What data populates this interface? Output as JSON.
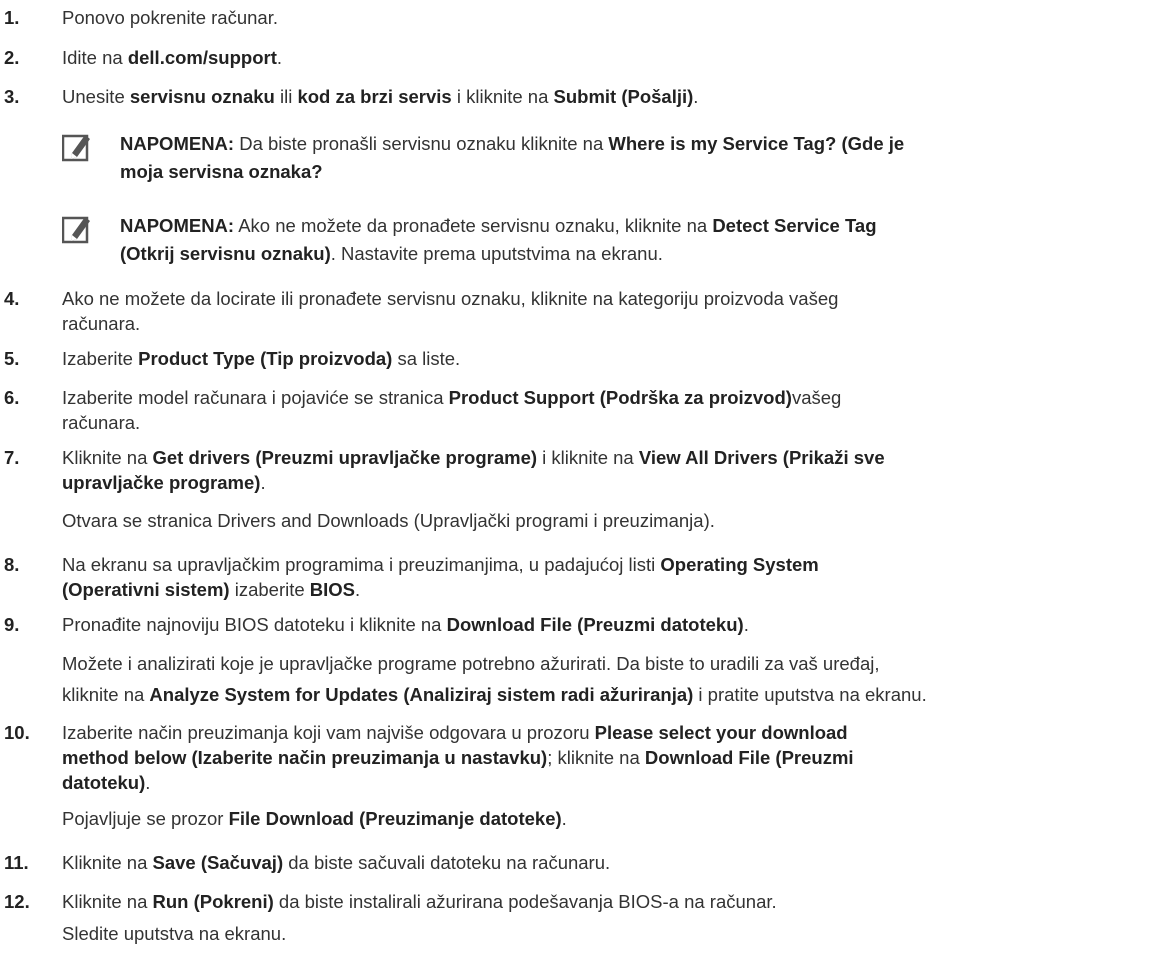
{
  "steps": [
    {
      "num": "1.",
      "parts": [
        {
          "t": "Ponovo pokrenite računar."
        }
      ]
    },
    {
      "num": "2.",
      "parts": [
        {
          "t": "Idite na "
        },
        {
          "b": "dell.com/support"
        },
        {
          "t": "."
        }
      ]
    },
    {
      "num": "3.",
      "parts": [
        {
          "t": "Unesite "
        },
        {
          "b": "servisnu oznaku"
        },
        {
          "t": " ili "
        },
        {
          "b": "kod za brzi servis"
        },
        {
          "t": " i kliknite na "
        },
        {
          "b": "Submit (Pošalji)"
        },
        {
          "t": "."
        }
      ]
    },
    {
      "num": "4.",
      "parts": [
        {
          "t": "Ako ne možete da locirate ili pronađete servisnu oznaku, kliknite na kategoriju proizvoda vašeg"
        }
      ],
      "line2": [
        {
          "t": "računara."
        }
      ]
    },
    {
      "num": "5.",
      "parts": [
        {
          "t": "Izaberite "
        },
        {
          "b": "Product Type (Tip proizvoda)"
        },
        {
          "t": " sa liste."
        }
      ]
    },
    {
      "num": "6.",
      "parts": [
        {
          "t": "Izaberite model računara i pojaviće se stranica "
        },
        {
          "b": "Product Support (Podrška za proizvod)"
        },
        {
          "t": "vašeg"
        }
      ],
      "line2": [
        {
          "t": "računara."
        }
      ]
    },
    {
      "num": "7.",
      "parts": [
        {
          "t": "Kliknite na "
        },
        {
          "b": "Get drivers (Preuzmi upravljačke programe)"
        },
        {
          "t": " i kliknite na "
        },
        {
          "b": "View All Drivers (Prikaži sve"
        }
      ],
      "line2": [
        {
          "b": "upravljačke programe)"
        },
        {
          "t": "."
        }
      ]
    },
    {
      "num": "8.",
      "parts": [
        {
          "t": "Na ekranu sa upravljačkim programima i preuzimanjima, u padajućoj listi "
        },
        {
          "b": "Operating System"
        }
      ],
      "line2": [
        {
          "b": "(Operativni sistem)"
        },
        {
          "t": " izaberite "
        },
        {
          "b": "BIOS"
        },
        {
          "t": "."
        }
      ]
    },
    {
      "num": "9.",
      "parts": [
        {
          "t": "Pronađite najnoviju BIOS datoteku i kliknite na "
        },
        {
          "b": "Download File (Preuzmi datoteku)"
        },
        {
          "t": "."
        }
      ]
    },
    {
      "num": "10.",
      "parts": [
        {
          "t": "Izaberite način preuzimanja koji vam najviše odgovara u prozoru "
        },
        {
          "b": "Please select your download"
        }
      ],
      "line2": [
        {
          "b": "method below (Izaberite način preuzimanja u nastavku)"
        },
        {
          "t": "; kliknite na "
        },
        {
          "b": "Download File (Preuzmi"
        }
      ],
      "line3": [
        {
          "b": "datoteku)"
        },
        {
          "t": "."
        }
      ]
    },
    {
      "num": "11.",
      "parts": [
        {
          "t": "Kliknite na "
        },
        {
          "b": "Save (Sačuvaj)"
        },
        {
          "t": " da biste sačuvali datoteku na računaru."
        }
      ]
    },
    {
      "num": "12.",
      "parts": [
        {
          "t": "Kliknite na "
        },
        {
          "b": "Run (Pokreni)"
        },
        {
          "t": " da biste instalirali ažurirana podešavanja BIOS-a na računar."
        }
      ]
    }
  ],
  "notes": [
    {
      "label": "NAPOMENA:",
      "line1": [
        {
          "t": " Da biste pronašli servisnu oznaku kliknite na "
        },
        {
          "b": "Where is my Service Tag? (Gde je"
        }
      ],
      "line2": [
        {
          "b": "moja servisna oznaka?"
        }
      ]
    },
    {
      "label": "NAPOMENA:",
      "line1": [
        {
          "t": " Ako ne možete da pronađete servisnu oznaku, kliknite na "
        },
        {
          "b": "Detect Service Tag"
        }
      ],
      "line2": [
        {
          "b": "(Otkrij servisnu oznaku)"
        },
        {
          "t": ". Nastavite prema uputstvima na ekranu."
        }
      ]
    }
  ],
  "subtexts": {
    "after7": "Otvara se stranica Drivers and Downloads (Upravljački programi i preuzimanja).",
    "after9_line1": [
      {
        "t": "Možete i analizirati koje je upravljačke programe potrebno ažurirati. Da biste to uradili za vaš uređaj,"
      }
    ],
    "after9_line2": [
      {
        "t": "kliknite na "
      },
      {
        "b": "Analyze System for Updates (Analiziraj sistem radi ažuriranja)"
      },
      {
        "t": " i pratite uputstva na ekranu."
      }
    ],
    "after10": [
      {
        "t": "Pojavljuje se prozor "
      },
      {
        "b": "File Download (Preuzimanje datoteke)"
      },
      {
        "t": "."
      }
    ],
    "after12": "Sledite uputstva na ekranu."
  },
  "icons": {
    "note": "pencil-note-icon"
  },
  "colors": {
    "text": "#333333",
    "bold": "#222222",
    "icon": "#555555"
  }
}
